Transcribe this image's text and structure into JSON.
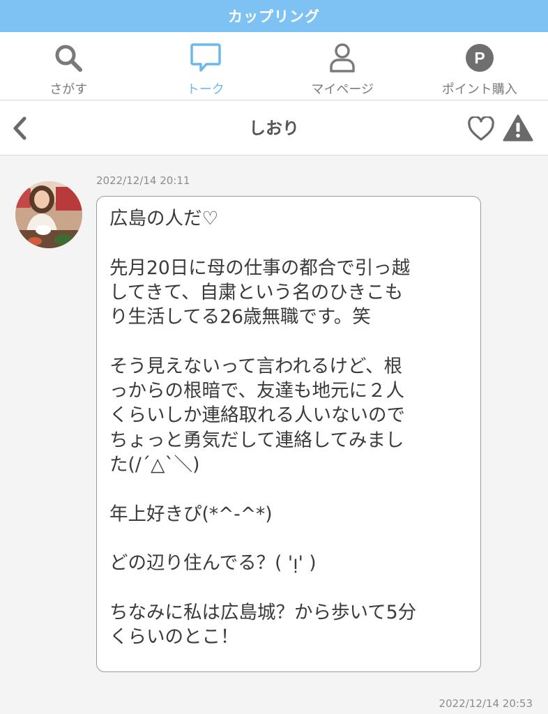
{
  "app": {
    "title": "カップリング",
    "accent_color": "#7ec2f4"
  },
  "tabs": [
    {
      "label": "さがす",
      "icon": "search-icon"
    },
    {
      "label": "トーク",
      "icon": "chat-bubble-icon",
      "active": true
    },
    {
      "label": "マイページ",
      "icon": "person-icon"
    },
    {
      "label": "ポイント購入",
      "icon": "points-icon",
      "icon_text": "P"
    }
  ],
  "chat": {
    "partner_name": "しおり",
    "back_icon": "chevron-left-icon",
    "like_icon": "heart-outline-icon",
    "report_icon": "warning-icon"
  },
  "messages": [
    {
      "timestamp": "2022/12/14 20:11",
      "text": "広島の人だ♡\n\n先月20日に母の仕事の都合で引っ越\nしてきて、自粛という名のひきこも\nり生活してる26歳無職です。笑\n\nそう見えないって言われるけど、根\nっからの根暗で、友達も地元に２人\nくらいしか連絡取れる人いないので\nちょっと勇気だして連絡してみまし\nた(/´△`＼)\n\n年上好きぴ(*^-^*)\n\nどの辺り住んでる？( 'ᴉ' )\n\nちなみに私は広島城？から歩いて5分\nくらいのとこ！"
    }
  ],
  "read_timestamp": "2022/12/14 20:53"
}
